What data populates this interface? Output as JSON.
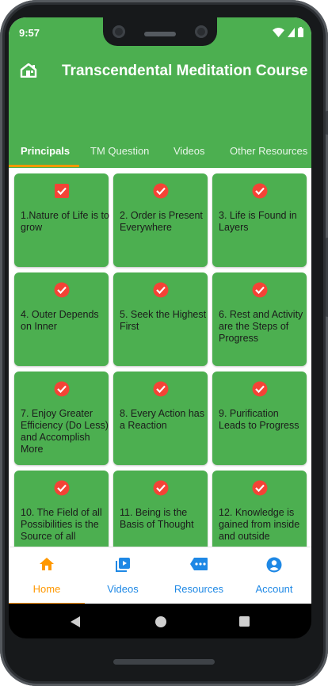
{
  "status_bar": {
    "time": "9:57"
  },
  "app_bar": {
    "title": "Transcendental Meditation Course",
    "home_icon": "home-icon"
  },
  "tabs": [
    {
      "label": "Principals",
      "active": true
    },
    {
      "label": "TM Question",
      "active": false
    },
    {
      "label": "Videos",
      "active": false
    },
    {
      "label": "Other Resources",
      "active": false
    }
  ],
  "cards": [
    {
      "label": "1.Nature of Life is to grow",
      "icon": "check-box-icon"
    },
    {
      "label": "2. Order is Present Everywhere",
      "icon": "check-circle-icon"
    },
    {
      "label": "3. Life is Found in Layers",
      "icon": "check-circle-icon"
    },
    {
      "label": "4. Outer Depends on Inner",
      "icon": "check-circle-icon"
    },
    {
      "label": "5. Seek the Highest First",
      "icon": "check-circle-icon"
    },
    {
      "label": "6. Rest and Activity are the Steps of Progress",
      "icon": "check-circle-icon"
    },
    {
      "label": "7. Enjoy Greater Efficiency (Do Less) and Accomplish More",
      "icon": "check-circle-icon"
    },
    {
      "label": "8. Every Action has a Reaction",
      "icon": "check-circle-icon"
    },
    {
      "label": "9. Purification Leads to Progress",
      "icon": "check-circle-icon"
    },
    {
      "label": "10. The Field of all Possibilities is the Source of all",
      "icon": "check-circle-icon"
    },
    {
      "label": "11. Being is the Basis of Thought",
      "icon": "check-circle-icon"
    },
    {
      "label": "12. Knowledge is gained from inside and outside",
      "icon": "check-circle-icon"
    }
  ],
  "bottom_nav": [
    {
      "label": "Home",
      "icon": "home-icon",
      "active": true
    },
    {
      "label": "Videos",
      "icon": "video-library-icon",
      "active": false
    },
    {
      "label": "Resources",
      "icon": "resources-icon",
      "active": false
    },
    {
      "label": "Account",
      "icon": "account-icon",
      "active": false
    }
  ],
  "colors": {
    "primary": "#4caf50",
    "accent": "#ff9800",
    "check_red": "#f44336",
    "nav_blue": "#1e88e5"
  }
}
